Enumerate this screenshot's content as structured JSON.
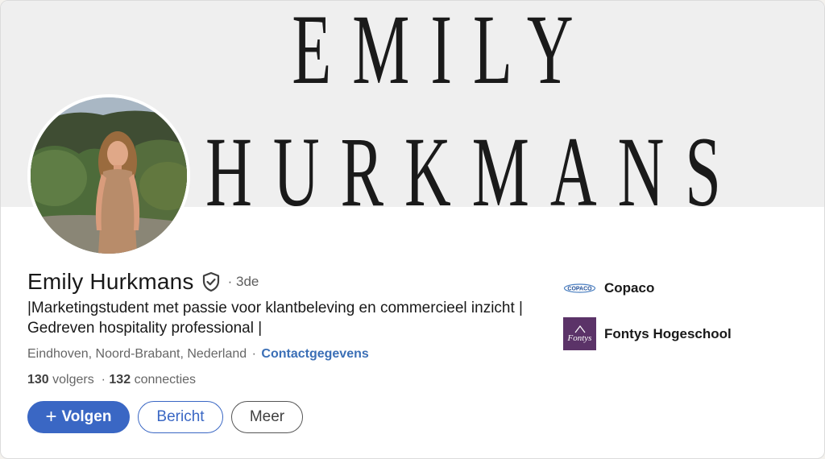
{
  "banner": {
    "line1": "EMILY",
    "line2": "HURKMANS"
  },
  "profile": {
    "name": "Emily Hurkmans",
    "degree": "· 3de",
    "headline": "|Marketingstudent met passie voor klantbeleving en commercieel inzicht | Gedreven hospitality professional |",
    "location": "Eindhoven, Noord-Brabant, Nederland",
    "location_separator": "·",
    "contact_link": "Contactgegevens",
    "followers_count": "130",
    "followers_label": "volgers",
    "connections_separator": "·",
    "connections_count": "132",
    "connections_label": "connecties"
  },
  "actions": {
    "follow_icon": "+",
    "follow_label": "Volgen",
    "message_label": "Bericht",
    "more_label": "Meer"
  },
  "organizations": [
    {
      "name": "Copaco",
      "logo_text": "COPACO",
      "icon": "copaco-logo"
    },
    {
      "name": "Fontys Hogeschool",
      "logo_text": "Fontys",
      "icon": "fontys-logo"
    }
  ],
  "colors": {
    "accent": "#3a67c4",
    "link": "#3b6fb6",
    "banner_bg": "#efefef",
    "fontys_purple": "#5b3368"
  }
}
